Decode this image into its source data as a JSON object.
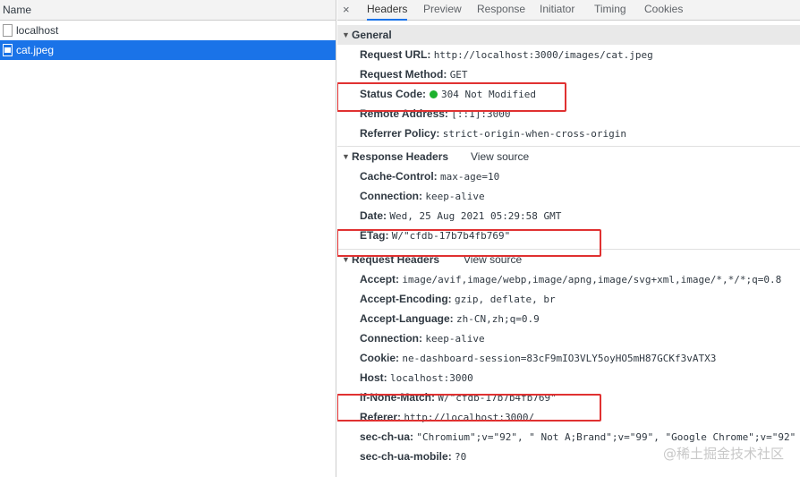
{
  "left": {
    "name_header": "Name",
    "files": [
      {
        "name": "localhost",
        "selected": false
      },
      {
        "name": "cat.jpeg",
        "selected": true
      }
    ]
  },
  "tabs": {
    "close_glyph": "×",
    "items": [
      "Headers",
      "Preview",
      "Response",
      "Initiator",
      "Timing",
      "Cookies"
    ],
    "active": "Headers"
  },
  "general": {
    "title": "General",
    "rows": [
      {
        "key": "Request URL:",
        "value": "http://localhost:3000/images/cat.jpeg"
      },
      {
        "key": "Request Method:",
        "value": "GET"
      },
      {
        "key": "Status Code:",
        "value": "304 Not Modified"
      },
      {
        "key": "Remote Address:",
        "value": "[::1]:3000"
      },
      {
        "key": "Referrer Policy:",
        "value": "strict-origin-when-cross-origin"
      }
    ]
  },
  "response_headers": {
    "title": "Response Headers",
    "view_source": "View source",
    "rows": [
      {
        "key": "Cache-Control:",
        "value": "max-age=10"
      },
      {
        "key": "Connection:",
        "value": "keep-alive"
      },
      {
        "key": "Date:",
        "value": "Wed, 25 Aug 2021 05:29:58 GMT"
      },
      {
        "key": "ETag:",
        "value": "W/\"cfdb-17b7b4fb769\""
      }
    ]
  },
  "request_headers": {
    "title": "Request Headers",
    "view_source": "View source",
    "rows": [
      {
        "key": "Accept:",
        "value": "image/avif,image/webp,image/apng,image/svg+xml,image/*,*/*;q=0.8"
      },
      {
        "key": "Accept-Encoding:",
        "value": "gzip, deflate, br"
      },
      {
        "key": "Accept-Language:",
        "value": "zh-CN,zh;q=0.9"
      },
      {
        "key": "Connection:",
        "value": "keep-alive"
      },
      {
        "key": "Cookie:",
        "value": "ne-dashboard-session=83cF9mIO3VLY5oyHO5mH87GCKf3vATX3"
      },
      {
        "key": "Host:",
        "value": "localhost:3000"
      },
      {
        "key": "If-None-Match:",
        "value": "W/\"cfdb-17b7b4fb769\""
      },
      {
        "key": "Referer:",
        "value": "http://localhost:3000/"
      },
      {
        "key": "sec-ch-ua:",
        "value": "\"Chromium\";v=\"92\", \" Not A;Brand\";v=\"99\", \"Google Chrome\";v=\"92\""
      },
      {
        "key": "sec-ch-ua-mobile:",
        "value": "?0"
      }
    ]
  },
  "colors": {
    "highlight": "#e03131",
    "status_ok": "#1db12d",
    "selected": "#1a73e8"
  },
  "watermark": "@稀土掘金技术社区"
}
